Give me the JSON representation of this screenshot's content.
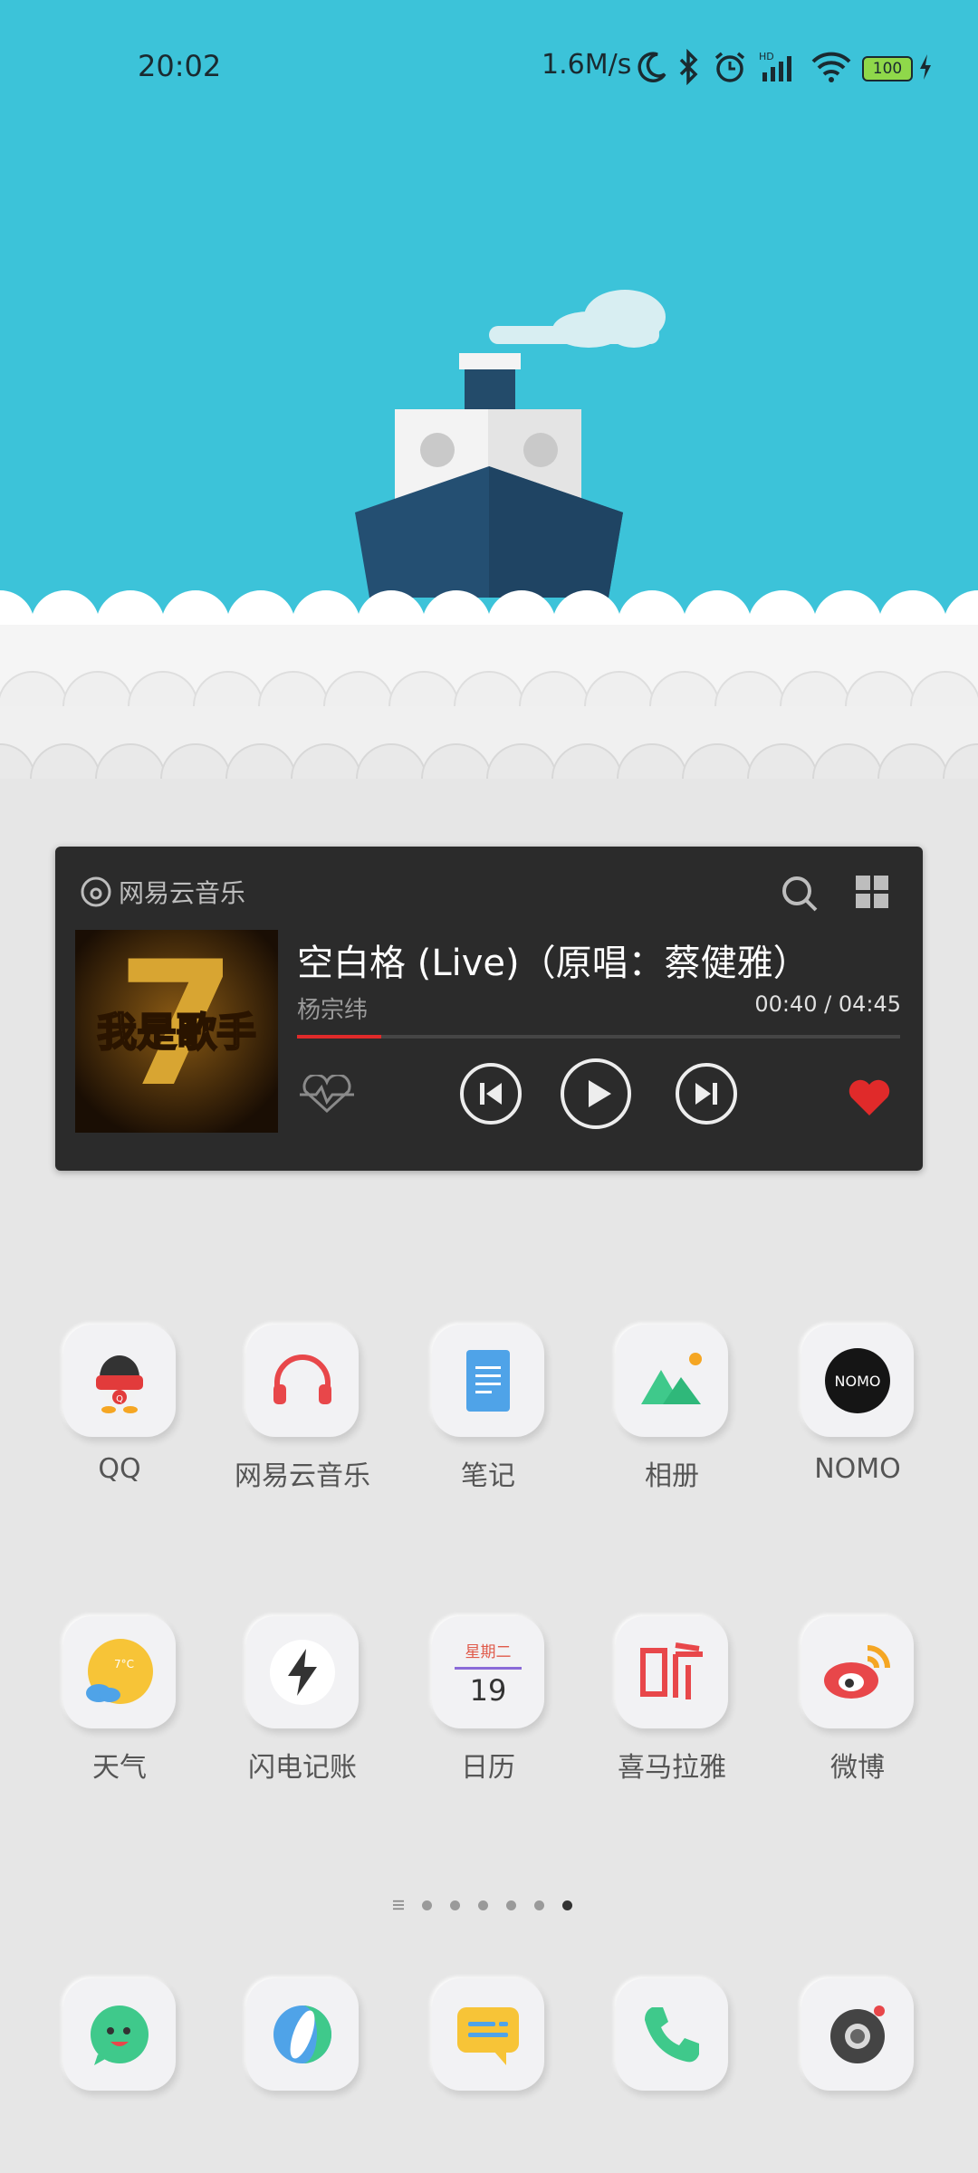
{
  "status_bar": {
    "time": "20:02",
    "net_speed": "1.6M/s",
    "battery": "100",
    "icons": [
      "moon-icon",
      "bluetooth-icon",
      "alarm-icon",
      "signal-hd-icon",
      "wifi-icon",
      "battery-icon",
      "charging-icon"
    ]
  },
  "music_widget": {
    "app_name": "网易云音乐",
    "song_title": "空白格 (Live)（原唱：蔡健雅）",
    "artist": "杨宗纬",
    "time": "00:40 / 04:45",
    "progress": 0.14,
    "accent": "#e02a2a",
    "cover_text": "我是歌手"
  },
  "apps_row1": [
    {
      "label": "QQ",
      "icon": "qq-icon"
    },
    {
      "label": "网易云音乐",
      "icon": "headphones-icon"
    },
    {
      "label": "笔记",
      "icon": "notes-icon"
    },
    {
      "label": "相册",
      "icon": "gallery-icon"
    },
    {
      "label": "NOMO",
      "icon": "nomo-icon",
      "icon_text": "NOMO"
    }
  ],
  "apps_row2": [
    {
      "label": "天气",
      "icon": "weather-icon",
      "icon_text": "7°C"
    },
    {
      "label": "闪电记账",
      "icon": "lightning-icon"
    },
    {
      "label": "日历",
      "icon": "calendar-icon",
      "icon_weekday": "星期二",
      "icon_day": "19"
    },
    {
      "label": "喜马拉雅",
      "icon": "ximalaya-icon"
    },
    {
      "label": "微博",
      "icon": "weibo-icon"
    }
  ],
  "page_indicator": {
    "pages": 6,
    "current": 6
  },
  "dock": [
    {
      "icon": "chat-icon"
    },
    {
      "icon": "browser-icon"
    },
    {
      "icon": "messages-icon"
    },
    {
      "icon": "phone-icon"
    },
    {
      "icon": "camera-icon"
    }
  ]
}
